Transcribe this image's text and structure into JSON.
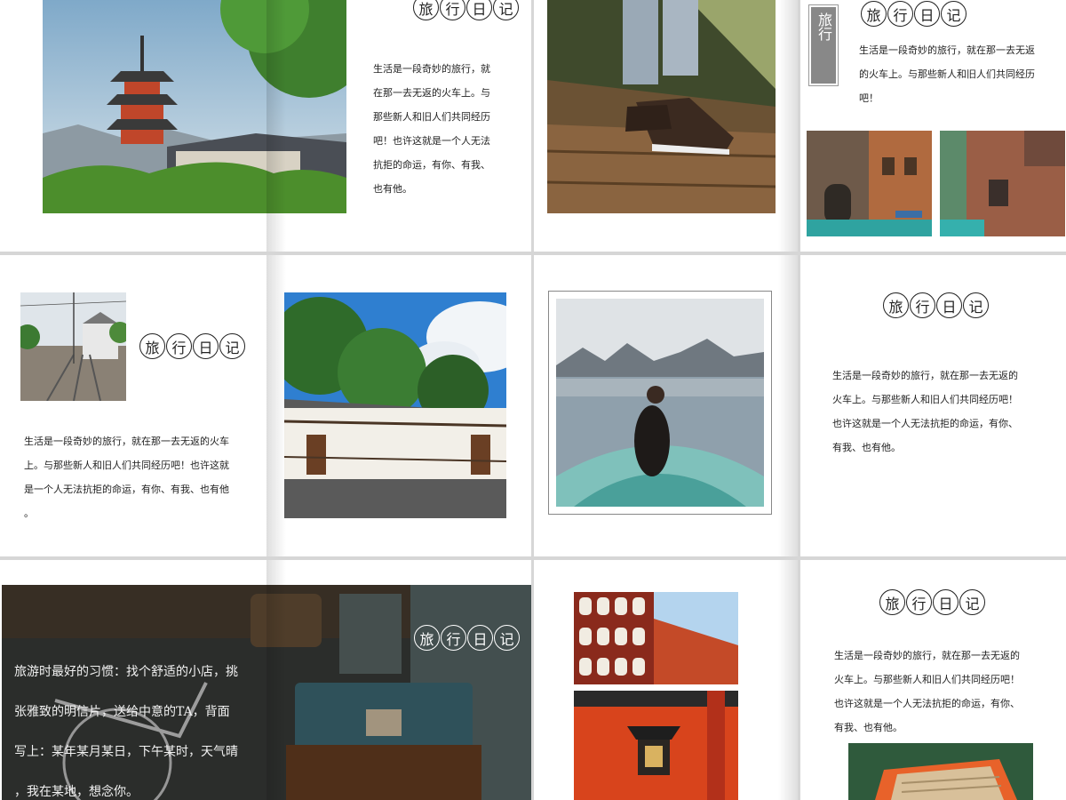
{
  "badge_chars": [
    "旅",
    "行",
    "日",
    "记"
  ],
  "vertical_tag": "旅行",
  "texts": {
    "s1_body": "生活是一段奇妙的旅行，就\n在那一去无返的火车上。与\n那些新人和旧人们共同经历\n吧！也许这就是一个人无法\n抗拒的命运，有你、有我、\n也有他。",
    "s4_body": "生活是一段奇妙的旅行，就在那一去无返\n的火车上。与那些新人和旧人们共同经历\n吧！",
    "s5_body": "生活是一段奇妙的旅行，就在那一去无返的火车\n上。与那些新人和旧人们共同经历吧！也许这就\n是一个人无法抗拒的命运，有你、有我、也有他\n。",
    "s8_body": "生活是一段奇妙的旅行，就在那一去无返的\n火车上。与那些新人和旧人们共同经历吧！\n也许这就是一个人无法抗拒的命运，有你、\n有我、也有他。",
    "s9_body": "旅游时最好的习惯：找个舒适的小店，挑\n张雅致的明信片，送给中意的TA，背面\n写上：某年某月某日，下午某时，天气晴\n，我在某地，想念你。",
    "s11_body": "生活是一段奇妙的旅行，就在那一去无返的\n火车上。与那些新人和旧人们共同经历吧！\n也许这就是一个人无法抗拒的命运，有你、\n有我、也有他。"
  }
}
